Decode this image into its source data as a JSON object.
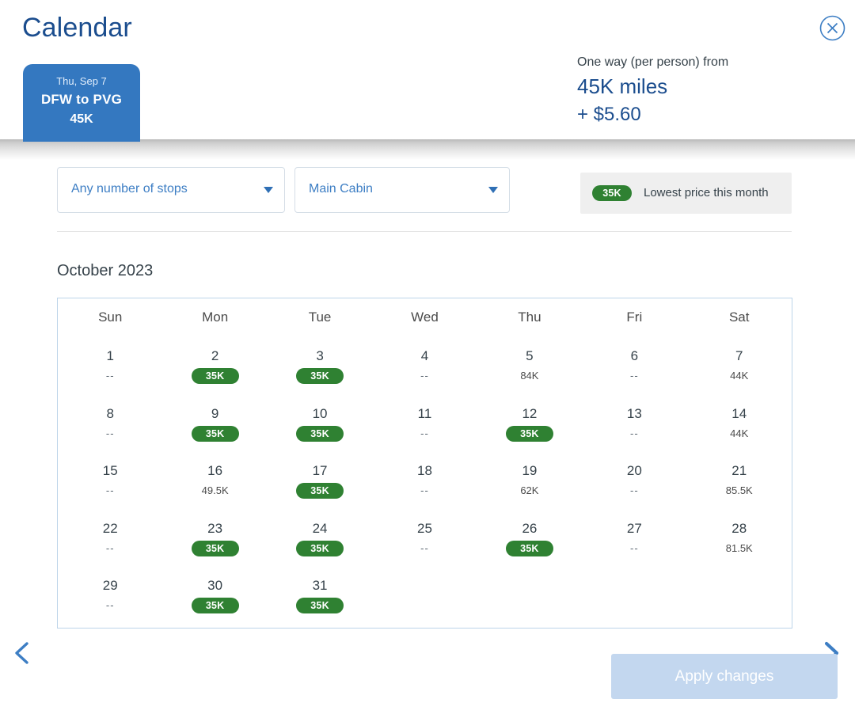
{
  "header": {
    "title": "Calendar",
    "close_icon": "close-circle-icon",
    "flight_tab": {
      "date": "Thu, Sep 7",
      "route": "DFW to PVG",
      "price": "45K"
    },
    "price_summary": {
      "label": "One way (per person) from",
      "miles": "45K miles",
      "fee": "+ $5.60"
    }
  },
  "filters": {
    "stops": {
      "value": "Any number of stops",
      "caret_icon": "chevron-down-icon"
    },
    "cabin": {
      "value": "Main Cabin",
      "caret_icon": "chevron-down-icon"
    },
    "legend": {
      "badge": "35K",
      "text": "Lowest price this month"
    }
  },
  "calendar": {
    "month_title": "October 2023",
    "day_headers": [
      "Sun",
      "Mon",
      "Tue",
      "Wed",
      "Thu",
      "Fri",
      "Sat"
    ],
    "prev_icon": "chevron-left-icon",
    "next_icon": "chevron-right-icon",
    "weeks": [
      [
        {
          "day": "1",
          "value": "--",
          "lowest": false
        },
        {
          "day": "2",
          "value": "35K",
          "lowest": true
        },
        {
          "day": "3",
          "value": "35K",
          "lowest": true
        },
        {
          "day": "4",
          "value": "--",
          "lowest": false
        },
        {
          "day": "5",
          "value": "84K",
          "lowest": false
        },
        {
          "day": "6",
          "value": "--",
          "lowest": false
        },
        {
          "day": "7",
          "value": "44K",
          "lowest": false
        }
      ],
      [
        {
          "day": "8",
          "value": "--",
          "lowest": false
        },
        {
          "day": "9",
          "value": "35K",
          "lowest": true
        },
        {
          "day": "10",
          "value": "35K",
          "lowest": true
        },
        {
          "day": "11",
          "value": "--",
          "lowest": false
        },
        {
          "day": "12",
          "value": "35K",
          "lowest": true
        },
        {
          "day": "13",
          "value": "--",
          "lowest": false
        },
        {
          "day": "14",
          "value": "44K",
          "lowest": false
        }
      ],
      [
        {
          "day": "15",
          "value": "--",
          "lowest": false
        },
        {
          "day": "16",
          "value": "49.5K",
          "lowest": false
        },
        {
          "day": "17",
          "value": "35K",
          "lowest": true
        },
        {
          "day": "18",
          "value": "--",
          "lowest": false
        },
        {
          "day": "19",
          "value": "62K",
          "lowest": false
        },
        {
          "day": "20",
          "value": "--",
          "lowest": false
        },
        {
          "day": "21",
          "value": "85.5K",
          "lowest": false
        }
      ],
      [
        {
          "day": "22",
          "value": "--",
          "lowest": false
        },
        {
          "day": "23",
          "value": "35K",
          "lowest": true
        },
        {
          "day": "24",
          "value": "35K",
          "lowest": true
        },
        {
          "day": "25",
          "value": "--",
          "lowest": false
        },
        {
          "day": "26",
          "value": "35K",
          "lowest": true
        },
        {
          "day": "27",
          "value": "--",
          "lowest": false
        },
        {
          "day": "28",
          "value": "81.5K",
          "lowest": false
        }
      ],
      [
        {
          "day": "29",
          "value": "--",
          "lowest": false
        },
        {
          "day": "30",
          "value": "35K",
          "lowest": true
        },
        {
          "day": "31",
          "value": "35K",
          "lowest": true
        },
        {
          "day": "",
          "value": "",
          "lowest": false
        },
        {
          "day": "",
          "value": "",
          "lowest": false
        },
        {
          "day": "",
          "value": "",
          "lowest": false
        },
        {
          "day": "",
          "value": "",
          "lowest": false
        }
      ]
    ]
  },
  "footer": {
    "apply_label": "Apply changes"
  },
  "colors": {
    "brand_blue": "#1b4d8e",
    "tab_blue": "#3478c0",
    "link_blue": "#3d7ec4",
    "lowest_green": "#2f8132",
    "calendar_border": "#bdd4e9",
    "apply_disabled": "#c3d7ef"
  }
}
